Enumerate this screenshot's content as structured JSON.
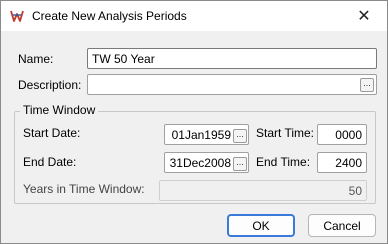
{
  "window": {
    "title": "Create New Analysis Periods",
    "app_icon": "hec-logo-icon",
    "close_glyph": "✕"
  },
  "form": {
    "name_label": "Name:",
    "name_value": "TW 50 Year",
    "description_label": "Description:",
    "description_value": "",
    "dots": "..."
  },
  "time_window": {
    "group_label": "Time Window",
    "start_date_label": "Start Date:",
    "start_date_value": "01Jan1959",
    "start_time_label": "Start Time:",
    "start_time_value": "0000",
    "end_date_label": "End Date:",
    "end_date_value": "31Dec2008",
    "end_time_label": "End Time:",
    "end_time_value": "2400",
    "years_label": "Years in Time Window:",
    "years_value": "50"
  },
  "buttons": {
    "ok": "OK",
    "cancel": "Cancel"
  },
  "colors": {
    "accent": "#3b7ad9",
    "window_bg": "#f0f0f0"
  }
}
